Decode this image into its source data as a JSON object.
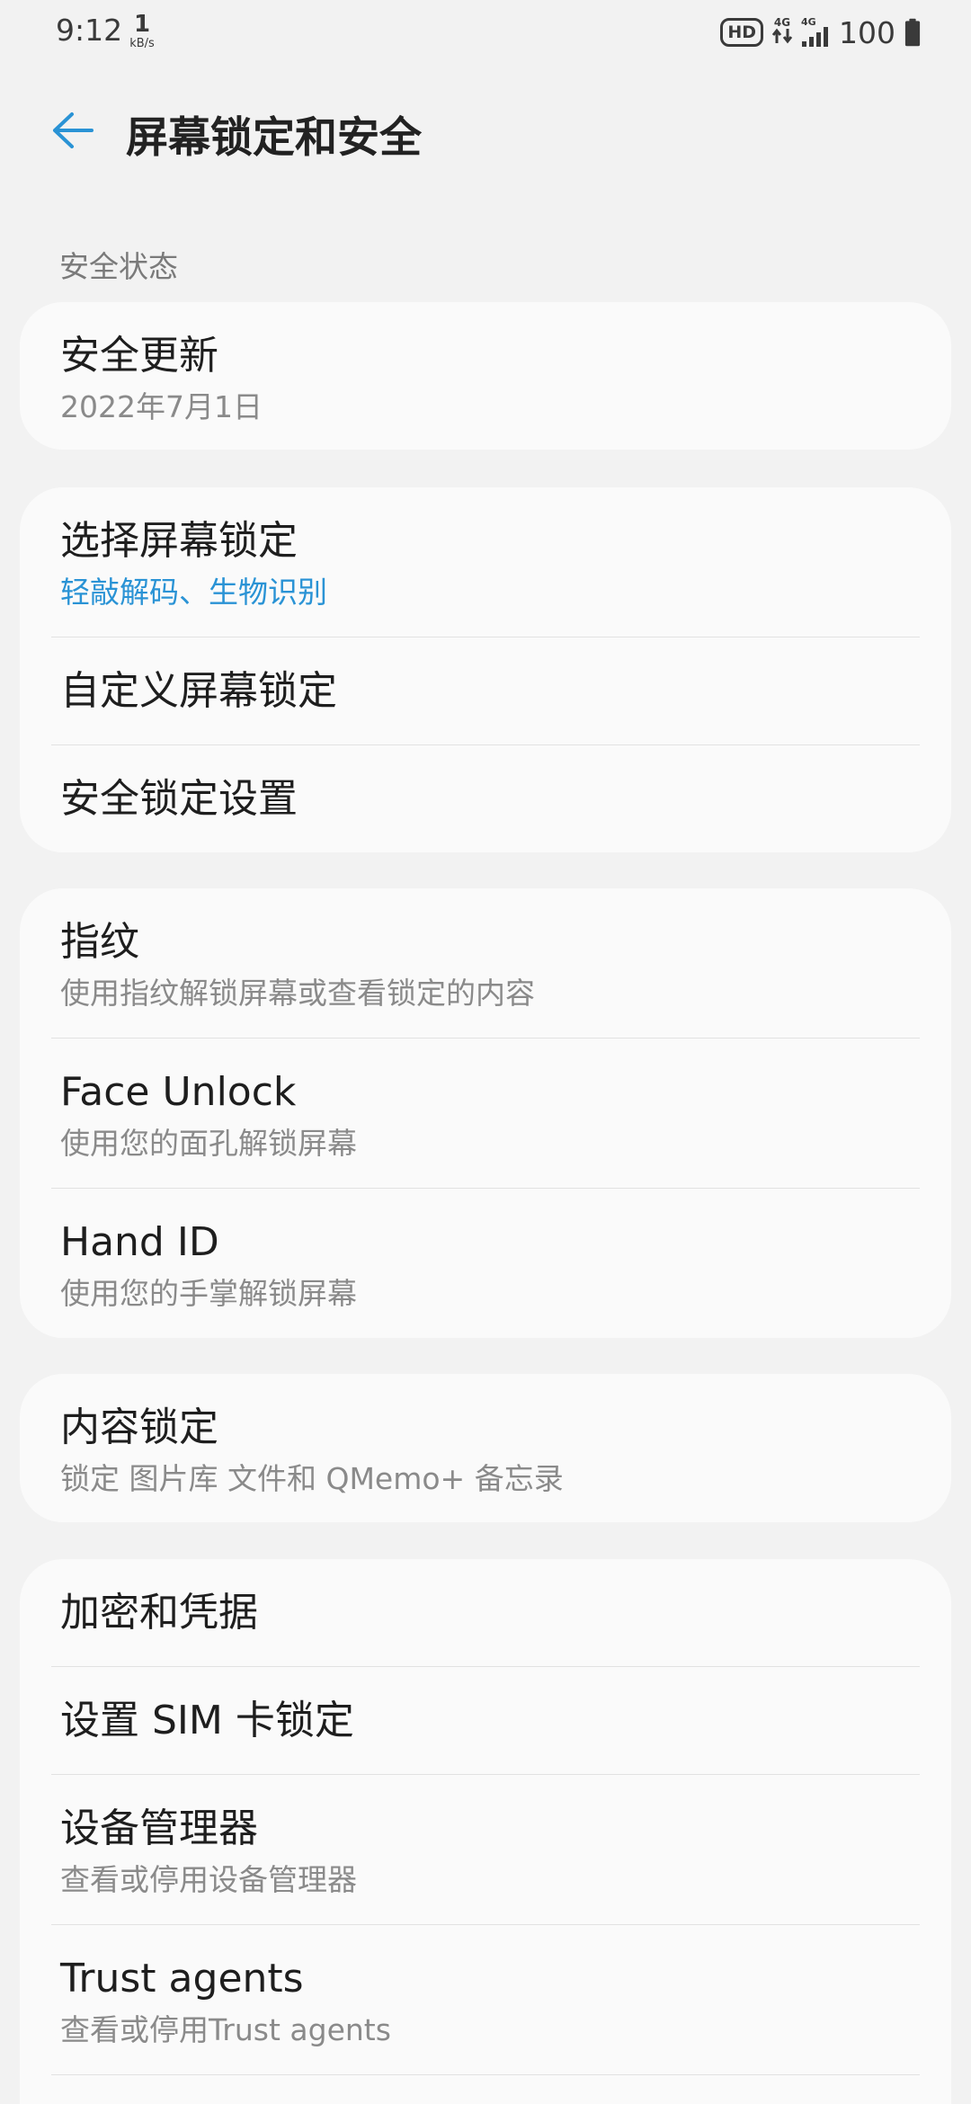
{
  "status_bar": {
    "time": "9:12",
    "net_speed_value": "1",
    "net_speed_unit": "kB/s",
    "hd_badge": "HD",
    "net_type_a": "4G",
    "net_type_b": "4G",
    "battery_percent": "100",
    "icons": [
      "hd-voice-icon",
      "data-transfer-icon",
      "signal-icon",
      "battery-icon"
    ]
  },
  "header": {
    "title": "屏幕锁定和安全",
    "back_icon": "back-arrow-icon"
  },
  "sections": {
    "security_status_header": "安全状态"
  },
  "cards": {
    "security_update": {
      "title": "安全更新",
      "subtitle": "2022年7月1日"
    },
    "lock": {
      "select_lock_title": "选择屏幕锁定",
      "select_lock_sub": "轻敲解码、生物识别",
      "customize_lock_title": "自定义屏幕锁定",
      "secure_lock_settings_title": "安全锁定设置"
    },
    "biometrics": {
      "fingerprint_title": "指纹",
      "fingerprint_sub": "使用指纹解锁屏幕或查看锁定的内容",
      "face_title": "Face Unlock",
      "face_sub": "使用您的面孔解锁屏幕",
      "hand_title": "Hand ID",
      "hand_sub": "使用您的手掌解锁屏幕"
    },
    "content_lock": {
      "title": "内容锁定",
      "subtitle": "锁定 图片库 文件和 QMemo+ 备忘录"
    },
    "advanced": {
      "encryption_title": "加密和凭据",
      "sim_lock_title": "设置 SIM 卡锁定",
      "device_admin_title": "设备管理器",
      "device_admin_sub": "查看或停用设备管理器",
      "trust_agents_title": "Trust agents",
      "trust_agents_sub": "查看或停用Trust agents"
    }
  },
  "colors": {
    "background": "#f2f2f2",
    "card": "#fafafa",
    "accent": "#2a93d5",
    "primary_text": "#1e1e1e",
    "secondary_text": "#8a8a8a"
  }
}
